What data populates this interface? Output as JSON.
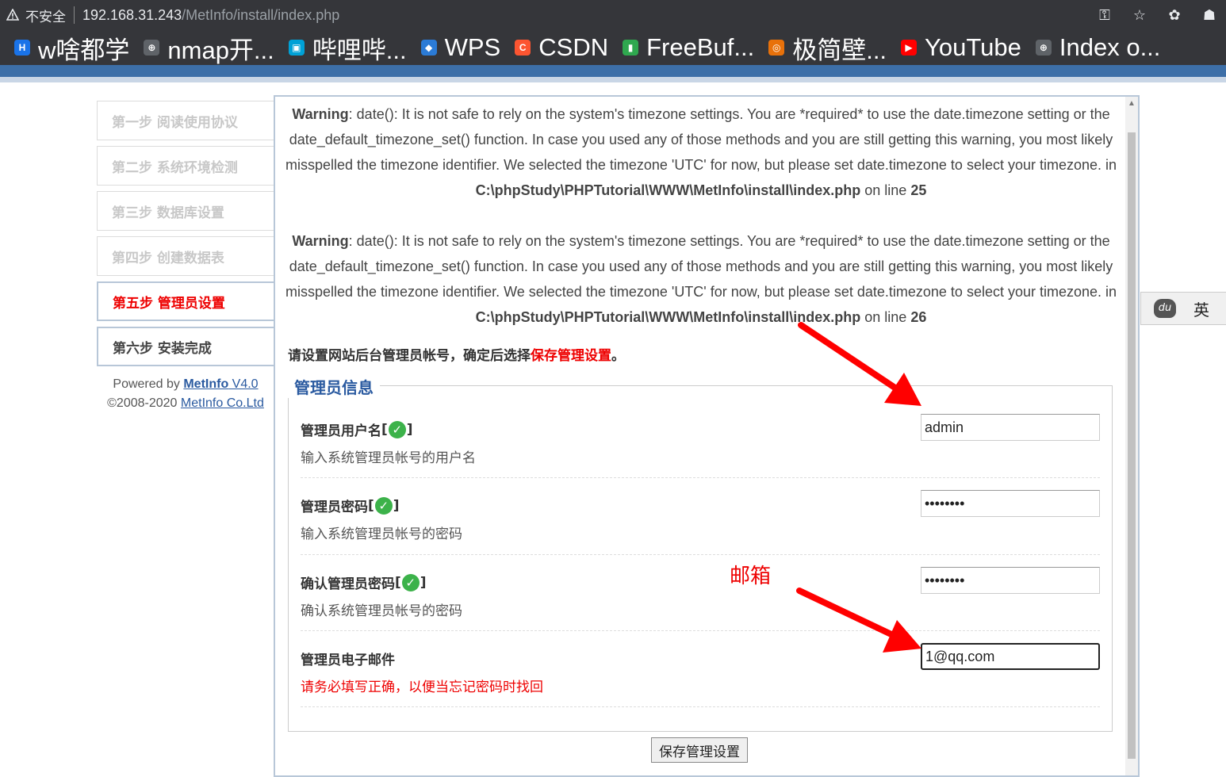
{
  "browser": {
    "insecure_label": "不安全",
    "url_host": "192.168.31.243",
    "url_path": "/MetInfo/install/index.php",
    "icons": [
      "key-icon",
      "star-icon",
      "extensions-icon",
      "profile-icon"
    ]
  },
  "bookmarks": [
    {
      "label": "w啥都学",
      "icon": "H",
      "color": "#1a73e8"
    },
    {
      "label": "nmap开...",
      "icon": "globe",
      "color": "#5f6368"
    },
    {
      "label": "哔哩哔...",
      "icon": "tv",
      "color": "#00a1d6"
    },
    {
      "label": "WPS",
      "icon": "cube",
      "color": "#2b7bd6"
    },
    {
      "label": "CSDN",
      "icon": "C",
      "color": "#fc5531"
    },
    {
      "label": "FreeBuf...",
      "icon": "bars",
      "color": "#2fa84f"
    },
    {
      "label": "极简壁...",
      "icon": "ring",
      "color": "#e8710a"
    },
    {
      "label": "YouTube",
      "icon": "play",
      "color": "#ff0000"
    },
    {
      "label": "Index o...",
      "icon": "globe",
      "color": "#5f6368"
    }
  ],
  "steps": [
    {
      "label": "第一步 阅读使用协议",
      "state": "done"
    },
    {
      "label": "第二步 系统环境检测",
      "state": "done"
    },
    {
      "label": "第三步 数据库设置",
      "state": "done"
    },
    {
      "label": "第四步 创建数据表",
      "state": "done"
    },
    {
      "label": "第五步 管理员设置",
      "state": "active"
    },
    {
      "label": "第六步 安装完成",
      "state": "next"
    }
  ],
  "powered": {
    "prefix": "Powered by ",
    "brand": "MetInfo",
    "version": " V4.0",
    "copyright_prefix": "©2008-2020 ",
    "company": "MetInfo Co.Ltd"
  },
  "warnings": [
    {
      "label": "Warning",
      "text": ": date(): It is not safe to rely on the system's timezone settings. You are *required* to use the date.timezone setting or the date_default_timezone_set() function. In case you used any of those methods and you are still getting this warning, you most likely misspelled the timezone identifier. We selected the timezone 'UTC' for now, but please set date.timezone to select your timezone. in ",
      "file": "C:\\phpStudy\\PHPTutorial\\WWW\\MetInfo\\install\\index.php",
      "on_line": " on line ",
      "line": "25"
    },
    {
      "label": "Warning",
      "text": ": date(): It is not safe to rely on the system's timezone settings. You are *required* to use the date.timezone setting or the date_default_timezone_set() function. In case you used any of those methods and you are still getting this warning, you most likely misspelled the timezone identifier. We selected the timezone 'UTC' for now, but please set date.timezone to select your timezone. in ",
      "file": "C:\\phpStudy\\PHPTutorial\\WWW\\MetInfo\\install\\index.php",
      "on_line": " on line ",
      "line": "26"
    }
  ],
  "intro": {
    "text": "请设置网站后台管理员帐号，确定后选择",
    "highlight": "保存管理设置",
    "end": "。"
  },
  "form": {
    "legend": "管理员信息",
    "fields": [
      {
        "label": "管理员用户名",
        "desc": "输入系统管理员帐号的用户名",
        "value": "admin",
        "valid": true,
        "bracket_open": " [",
        "bracket_close": "]"
      },
      {
        "label": "管理员密码",
        "desc": "输入系统管理员帐号的密码",
        "value": "••••••••",
        "valid": true,
        "bracket_open": " [",
        "bracket_close": "]"
      },
      {
        "label": "确认管理员密码",
        "desc": "确认系统管理员帐号的密码",
        "value": "••••••••",
        "valid": true,
        "bracket_open": " [",
        "bracket_close": "]"
      },
      {
        "label": "管理员电子邮件",
        "desc": "请务必填写正确，以便当忘记密码时找回",
        "value": "1@qq.com",
        "valid": false
      }
    ],
    "submit": "保存管理设置"
  },
  "annotation": {
    "text": "邮箱",
    "color": "#ee0000"
  },
  "ime": {
    "badge": "du",
    "lang": "英"
  }
}
